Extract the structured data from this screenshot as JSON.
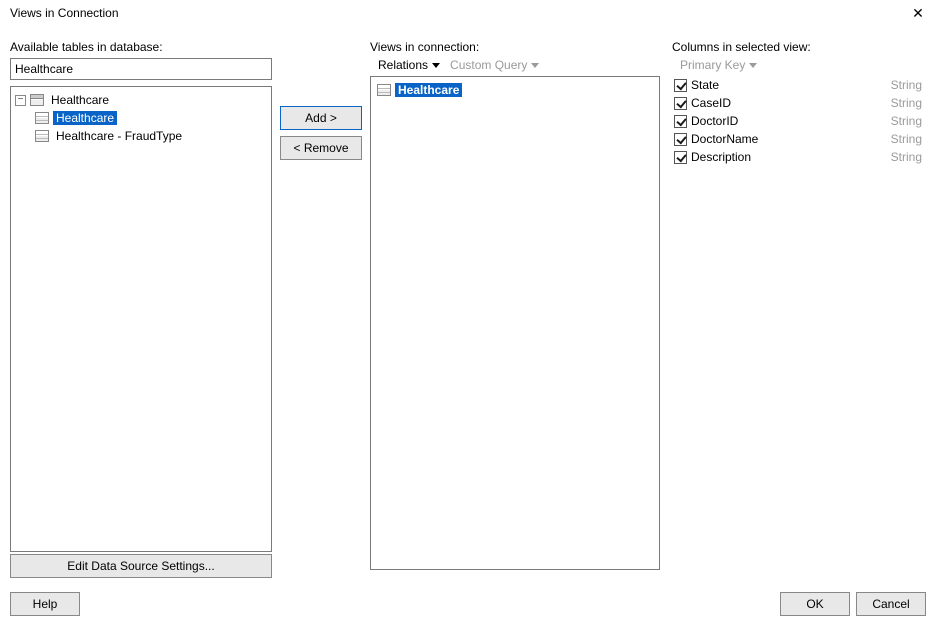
{
  "window": {
    "title": "Views in Connection"
  },
  "left": {
    "label": "Available tables in database:",
    "search_value": "Healthcare",
    "tree": {
      "root": "Healthcare",
      "items": [
        {
          "label": "Healthcare",
          "selected": true
        },
        {
          "label": "Healthcare - FraudType",
          "selected": false
        }
      ]
    },
    "edit_ds": "Edit Data Source Settings..."
  },
  "buttons": {
    "add": "Add >",
    "remove": "< Remove"
  },
  "mid": {
    "label": "Views in connection:",
    "relations": "Relations",
    "custom_query": "Custom Query",
    "items": [
      {
        "label": "Healthcare",
        "selected": true
      }
    ]
  },
  "right": {
    "label": "Columns in selected view:",
    "primary_key": "Primary Key",
    "columns": [
      {
        "name": "State",
        "type": "String",
        "checked": true
      },
      {
        "name": "CaseID",
        "type": "String",
        "checked": true
      },
      {
        "name": "DoctorID",
        "type": "String",
        "checked": true
      },
      {
        "name": "DoctorName",
        "type": "String",
        "checked": true
      },
      {
        "name": "Description",
        "type": "String",
        "checked": true
      }
    ]
  },
  "bottom": {
    "help": "Help",
    "ok": "OK",
    "cancel": "Cancel"
  }
}
